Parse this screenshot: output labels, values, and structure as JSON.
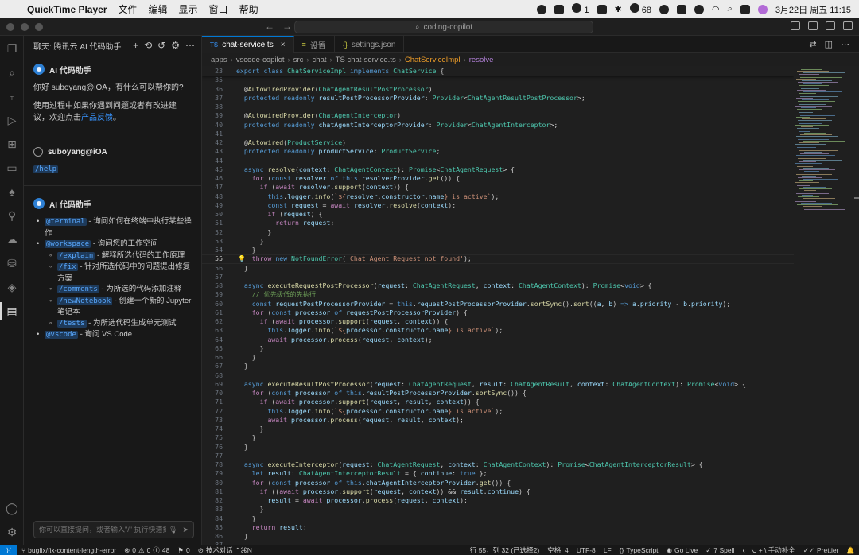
{
  "menubar": {
    "app_name": "QuickTime Player",
    "menus": [
      "文件",
      "编辑",
      "显示",
      "窗口",
      "帮助"
    ],
    "wechat_badge": "1",
    "battery": "68",
    "clock": "3月22日 周五  11:15"
  },
  "titlebar": {
    "back": "←",
    "forward": "→",
    "search_text": "coding-copilot"
  },
  "sidebar": {
    "title": "聊天: 腾讯云 AI 代码助手",
    "bot_name": "AI 代码助手",
    "greeting": "你好 suboyang@iOA，有什么可以帮你的?",
    "feedback_text": "使用过程中如果你遇到问题或者有改进建议，欢迎点击",
    "feedback_link": "产品反馈",
    "feedback_end": "。",
    "user_name": "suboyang@iOA",
    "user_message": "/help",
    "commands": [
      {
        "cmd": "@terminal",
        "desc": " - 询问如何在终端中执行某些操作",
        "sub": false
      },
      {
        "cmd": "@workspace",
        "desc": " - 询问您的工作空间",
        "sub": false
      },
      {
        "cmd": "/explain",
        "desc": " - 解释所选代码的工作原理",
        "sub": true
      },
      {
        "cmd": "/fix",
        "desc": " - 针对所选代码中的问题提出修复方案",
        "sub": true
      },
      {
        "cmd": "/comments",
        "desc": " - 为所选的代码添加注释",
        "sub": true
      },
      {
        "cmd": "/newNotebook",
        "desc": " - 创建一个新的 Jupyter 笔记本",
        "sub": true
      },
      {
        "cmd": "/tests",
        "desc": " - 为所选代码生成单元测试",
        "sub": true
      },
      {
        "cmd": "@vscode",
        "desc": " - 询问 VS Code",
        "sub": false
      }
    ],
    "input_placeholder": "你可以直接提问，或者输入\"/\" 执行快速操作"
  },
  "tabs": [
    {
      "badge": "TS",
      "label": "chat-service.ts",
      "active": true
    },
    {
      "badge": "{}",
      "label": "设置",
      "active": false
    },
    {
      "badge": "{}",
      "label": "settings.json",
      "active": false
    }
  ],
  "breadcrumb": [
    "apps",
    "vscode-copilot",
    "src",
    "chat",
    "TS chat-service.ts",
    "ChatServiceImpl",
    "resolve"
  ],
  "editor": {
    "current_line": "55",
    "lines": [
      {
        "n": "23",
        "html": "<span class='kw'>export</span> <span class='kw'>class</span> <span class='ty'>ChatServiceImpl</span> <span class='kw'>implements</span> <span class='ty'>ChatService</span> {"
      },
      {
        "n": "35",
        "html": ""
      },
      {
        "n": "36",
        "html": "  @<span class='fn'>AutowiredProvider</span>(<span class='ty'>ChatAgentResultPostProcessor</span>)"
      },
      {
        "n": "37",
        "html": "  <span class='kw'>protected</span> <span class='kw'>readonly</span> <span class='vr'>resultPostProcessorProvider</span>: <span class='ty'>Provider</span>&lt;<span class='ty'>ChatAgentResultPostProcessor</span>&gt;;"
      },
      {
        "n": "38",
        "html": ""
      },
      {
        "n": "39",
        "html": "  @<span class='fn'>AutowiredProvider</span>(<span class='ty'>ChatAgentInterceptor</span>)"
      },
      {
        "n": "40",
        "html": "  <span class='kw'>protected</span> <span class='kw'>readonly</span> <span class='vr'>chatAgentInterceptorProvider</span>: <span class='ty'>Provider</span>&lt;<span class='ty'>ChatAgentInterceptor</span>&gt;;"
      },
      {
        "n": "41",
        "html": ""
      },
      {
        "n": "42",
        "html": "  @<span class='fn'>Autowired</span>(<span class='ty'>ProductService</span>)"
      },
      {
        "n": "43",
        "html": "  <span class='kw'>protected</span> <span class='kw'>readonly</span> <span class='vr'>productService</span>: <span class='ty'>ProductService</span>;"
      },
      {
        "n": "44",
        "html": ""
      },
      {
        "n": "45",
        "html": "  <span class='kw'>async</span> <span class='fn'>resolve</span>(<span class='vr'>context</span>: <span class='ty'>ChatAgentContext</span>): <span class='ty'>Promise</span>&lt;<span class='ty'>ChatAgentRequest</span>&gt; {"
      },
      {
        "n": "46",
        "html": "    <span class='ctl'>for</span> (<span class='kw'>const</span> <span class='vr'>resolver</span> <span class='kw'>of</span> <span class='kw'>this</span>.<span class='vr'>resolverProvider</span>.<span class='fn'>get</span>()) {"
      },
      {
        "n": "47",
        "html": "      <span class='ctl'>if</span> (<span class='ctl'>await</span> <span class='vr'>resolver</span>.<span class='fn'>support</span>(<span class='vr'>context</span>)) {"
      },
      {
        "n": "48",
        "html": "        <span class='kw'>this</span>.<span class='vr'>logger</span>.<span class='fn'>info</span>(<span class='str'>`${</span><span class='vr'>resolver</span>.<span class='vr'>constructor</span>.<span class='vr'>name</span><span class='str'>} is active`</span>);"
      },
      {
        "n": "49",
        "html": "        <span class='kw'>const</span> <span class='vr'>request</span> = <span class='ctl'>await</span> <span class='vr'>resolver</span>.<span class='fn'>resolve</span>(<span class='vr'>context</span>);"
      },
      {
        "n": "50",
        "html": "        <span class='ctl'>if</span> (<span class='vr'>request</span>) {"
      },
      {
        "n": "51",
        "html": "          <span class='ctl'>return</span> <span class='vr'>request</span>;"
      },
      {
        "n": "52",
        "html": "        }"
      },
      {
        "n": "53",
        "html": "      }"
      },
      {
        "n": "54",
        "html": "    }"
      },
      {
        "n": "55",
        "html": "    <span class='ctl'>throw</span> <span class='kw'>new</span> <span class='ty'>NotFoundError</span>(<span class='str'>'Chat Agent Request not found'</span>);"
      },
      {
        "n": "56",
        "html": "  }"
      },
      {
        "n": "57",
        "html": ""
      },
      {
        "n": "58",
        "html": "  <span class='kw'>async</span> <span class='fn'>executeRequestPostProcessor</span>(<span class='vr'>request</span>: <span class='ty'>ChatAgentRequest</span>, <span class='vr'>context</span>: <span class='ty'>ChatAgentContext</span>): <span class='ty'>Promise</span>&lt;<span class='kw'>void</span>&gt; {"
      },
      {
        "n": "59",
        "html": "    <span class='cm'>// 优先级低的先执行</span>"
      },
      {
        "n": "60",
        "html": "    <span class='kw'>const</span> <span class='vr'>requestPostProcessorProvider</span> = <span class='kw'>this</span>.<span class='vr'>requestPostProcessorProvider</span>.<span class='fn'>sortSync</span>().<span class='fn'>sort</span>((<span class='vr'>a</span>, <span class='vr'>b</span>) <span class='kw'>=&gt;</span> <span class='vr'>a</span>.<span class='vr'>priority</span> - <span class='vr'>b</span>.<span class='vr'>priority</span>);"
      },
      {
        "n": "61",
        "html": "    <span class='ctl'>for</span> (<span class='kw'>const</span> <span class='vr'>processor</span> <span class='kw'>of</span> <span class='vr'>requestPostProcessorProvider</span>) {"
      },
      {
        "n": "62",
        "html": "      <span class='ctl'>if</span> (<span class='ctl'>await</span> <span class='vr'>processor</span>.<span class='fn'>support</span>(<span class='vr'>request</span>, <span class='vr'>context</span>)) {"
      },
      {
        "n": "63",
        "html": "        <span class='kw'>this</span>.<span class='vr'>logger</span>.<span class='fn'>info</span>(<span class='str'>`${</span><span class='vr'>processor</span>.<span class='vr'>constructor</span>.<span class='vr'>name</span><span class='str'>} is active`</span>);"
      },
      {
        "n": "64",
        "html": "        <span class='ctl'>await</span> <span class='vr'>processor</span>.<span class='fn'>process</span>(<span class='vr'>request</span>, <span class='vr'>context</span>);"
      },
      {
        "n": "65",
        "html": "      }"
      },
      {
        "n": "66",
        "html": "    }"
      },
      {
        "n": "67",
        "html": "  }"
      },
      {
        "n": "68",
        "html": ""
      },
      {
        "n": "69",
        "html": "  <span class='kw'>async</span> <span class='fn'>executeResultPostProcessor</span>(<span class='vr'>request</span>: <span class='ty'>ChatAgentRequest</span>, <span class='vr'>result</span>: <span class='ty'>ChatAgentResult</span>, <span class='vr'>context</span>: <span class='ty'>ChatAgentContext</span>): <span class='ty'>Promise</span>&lt;<span class='kw'>void</span>&gt; {"
      },
      {
        "n": "70",
        "html": "    <span class='ctl'>for</span> (<span class='kw'>const</span> <span class='vr'>processor</span> <span class='kw'>of</span> <span class='kw'>this</span>.<span class='vr'>resultPostProcessorProvider</span>.<span class='fn'>sortSync</span>()) {"
      },
      {
        "n": "71",
        "html": "      <span class='ctl'>if</span> (<span class='ctl'>await</span> <span class='vr'>processor</span>.<span class='fn'>support</span>(<span class='vr'>request</span>, <span class='vr'>result</span>, <span class='vr'>context</span>)) {"
      },
      {
        "n": "72",
        "html": "        <span class='kw'>this</span>.<span class='vr'>logger</span>.<span class='fn'>info</span>(<span class='str'>`${</span><span class='vr'>processor</span>.<span class='vr'>constructor</span>.<span class='vr'>name</span><span class='str'>} is active`</span>);"
      },
      {
        "n": "73",
        "html": "        <span class='ctl'>await</span> <span class='vr'>processor</span>.<span class='fn'>process</span>(<span class='vr'>request</span>, <span class='vr'>result</span>, <span class='vr'>context</span>);"
      },
      {
        "n": "74",
        "html": "      }"
      },
      {
        "n": "75",
        "html": "    }"
      },
      {
        "n": "76",
        "html": "  }"
      },
      {
        "n": "77",
        "html": ""
      },
      {
        "n": "78",
        "html": "  <span class='kw'>async</span> <span class='fn'>executeInterceptor</span>(<span class='vr'>request</span>: <span class='ty'>ChatAgentRequest</span>, <span class='vr'>context</span>: <span class='ty'>ChatAgentContext</span>): <span class='ty'>Promise</span>&lt;<span class='ty'>ChatAgentInterceptorResult</span>&gt; {"
      },
      {
        "n": "79",
        "html": "    <span class='kw'>let</span> <span class='vr'>result</span>: <span class='ty'>ChatAgentInterceptorResult</span> = { <span class='vr'>continue</span>: <span class='kw'>true</span> };"
      },
      {
        "n": "80",
        "html": "    <span class='ctl'>for</span> (<span class='kw'>const</span> <span class='vr'>processor</span> <span class='kw'>of</span> <span class='kw'>this</span>.<span class='vr'>chatAgentInterceptorProvider</span>.<span class='fn'>get</span>()) {"
      },
      {
        "n": "81",
        "html": "      <span class='ctl'>if</span> ((<span class='ctl'>await</span> <span class='vr'>processor</span>.<span class='fn'>support</span>(<span class='vr'>request</span>, <span class='vr'>context</span>)) &amp;&amp; <span class='vr'>result</span>.<span class='vr'>continue</span>) {"
      },
      {
        "n": "82",
        "html": "        <span class='vr'>result</span> = <span class='ctl'>await</span> <span class='vr'>processor</span>.<span class='fn'>process</span>(<span class='vr'>request</span>, <span class='vr'>context</span>);"
      },
      {
        "n": "83",
        "html": "      }"
      },
      {
        "n": "84",
        "html": "    }"
      },
      {
        "n": "85",
        "html": "    <span class='ctl'>return</span> <span class='vr'>result</span>;"
      },
      {
        "n": "86",
        "html": "  }"
      },
      {
        "n": "87",
        "html": ""
      }
    ]
  },
  "statusbar": {
    "branch": "bugfix/fix-content-length-error",
    "errors": "0",
    "warnings": "0",
    "info": "48",
    "ports": "0",
    "tech_support": "技术对话 ⌃⌘N",
    "cursor": "行 55，列 32 (已选择2)",
    "spaces": "空格: 4",
    "encoding": "UTF-8",
    "eol": "LF",
    "language": "TypeScript",
    "golive": "Go Live",
    "spell": "7 Spell",
    "completion": "⌥ + \\ 手动补全",
    "prettier": "Prettier"
  }
}
